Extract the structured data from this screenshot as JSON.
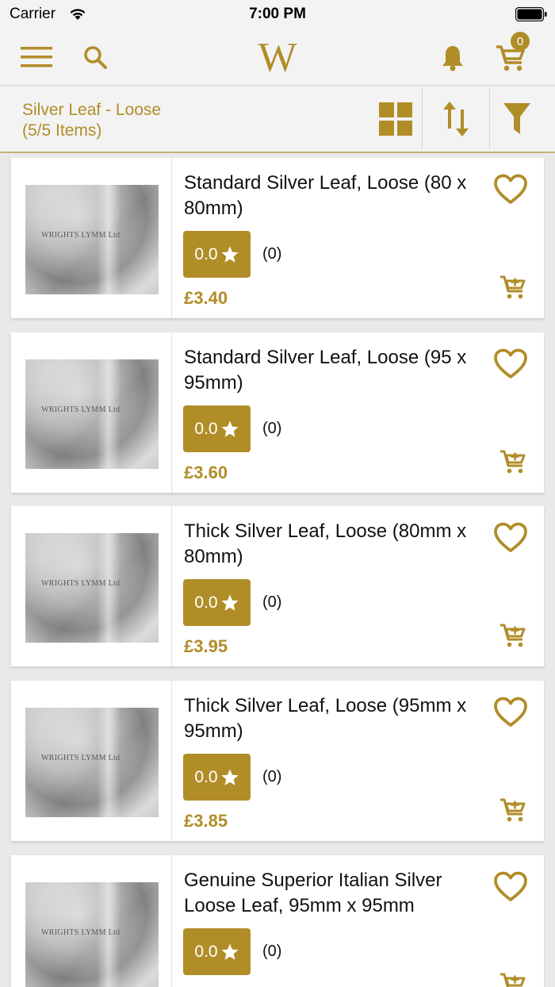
{
  "status_bar": {
    "carrier": "Carrier",
    "time": "7:00 PM"
  },
  "header": {
    "logo": "W",
    "cart_count": "0"
  },
  "toolbar": {
    "category_title": "Silver Leaf - Loose",
    "item_count": "(5/5 Items)"
  },
  "colors": {
    "accent": "#b18d28",
    "background": "#e9e9e9",
    "bar": "#f3f3f3"
  },
  "icons": [
    "menu-icon",
    "search-icon",
    "bell-icon",
    "cart-icon",
    "grid-view-icon",
    "sort-icon",
    "filter-icon",
    "heart-icon",
    "star-icon",
    "add-to-cart-icon"
  ],
  "thumbnail_watermark": "WRIGHTS LYMM Ltd",
  "products": [
    {
      "title": "Standard Silver Leaf, Loose (80 x 80mm)",
      "rating": "0.0",
      "reviews": "(0)",
      "price": "£3.40"
    },
    {
      "title": "Standard Silver Leaf, Loose (95 x 95mm)",
      "rating": "0.0",
      "reviews": "(0)",
      "price": "£3.60"
    },
    {
      "title": "Thick Silver Leaf, Loose (80mm x 80mm)",
      "rating": "0.0",
      "reviews": "(0)",
      "price": "£3.95"
    },
    {
      "title": "Thick Silver Leaf, Loose (95mm x 95mm)",
      "rating": "0.0",
      "reviews": "(0)",
      "price": "£3.85"
    },
    {
      "title": "Genuine Superior Italian Silver Loose Leaf, 95mm x 95mm",
      "rating": "0.0",
      "reviews": "(0)",
      "price": ""
    }
  ]
}
